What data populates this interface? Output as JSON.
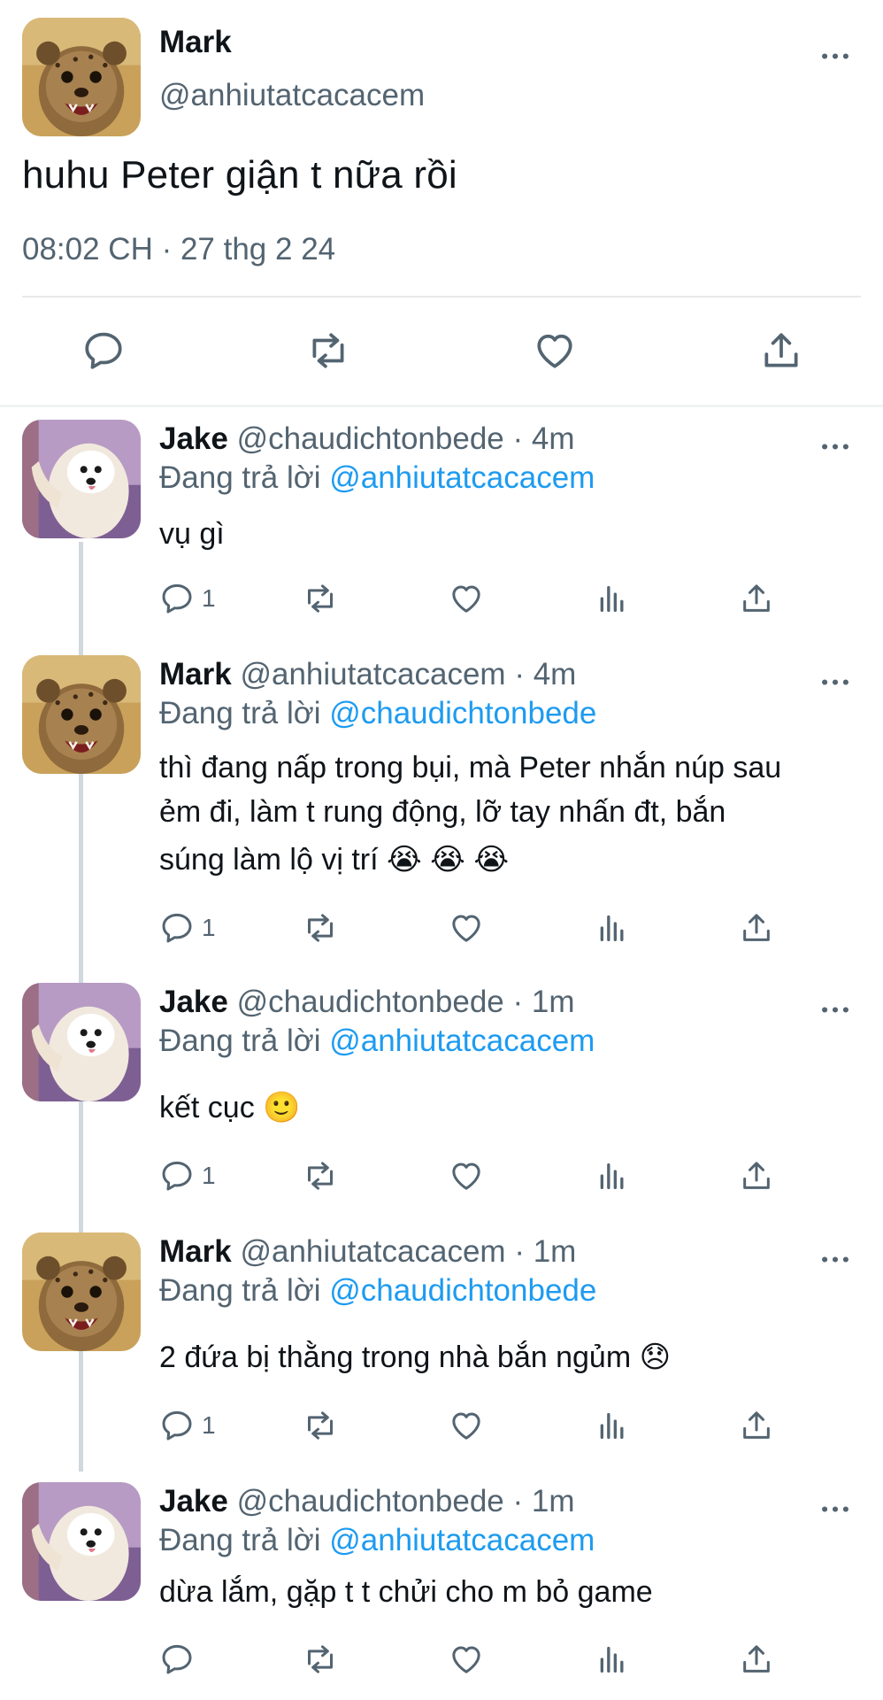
{
  "main_tweet": {
    "author": "Mark",
    "handle": "@anhiutatcacacem",
    "text": "huhu Peter giận t nữa rồi",
    "timestamp": "08:02 CH · 27 thg 2 24",
    "avatar": "cheetah-cub-avatar",
    "actions": [
      "reply-icon",
      "retweet-icon",
      "like-icon",
      "share-icon"
    ]
  },
  "replies": [
    {
      "author": "Jake",
      "handle": "@chaudichtonbede",
      "time": "4m",
      "replying_label": "Đang trả lời",
      "replying_to": "@anhiutatcacacem",
      "text_lines": [
        "vụ gì"
      ],
      "emoji": "",
      "reply_count": "1",
      "avatar": "white-dog-avatar"
    },
    {
      "author": "Mark",
      "handle": "@anhiutatcacacem",
      "time": "4m",
      "replying_label": "Đang trả lời",
      "replying_to": "@chaudichtonbede",
      "text_lines": [
        "thì đang nấp trong bụi, mà Peter nhắn núp sau",
        "ẻm đi, làm t rung động, lỡ tay nhấn đt, bắn",
        "súng làm lộ vị trí"
      ],
      "emoji": "😭 😭 😭",
      "reply_count": "1",
      "avatar": "cheetah-cub-avatar"
    },
    {
      "author": "Jake",
      "handle": "@chaudichtonbede",
      "time": "1m",
      "replying_label": "Đang trả lời",
      "replying_to": "@anhiutatcacacem",
      "text_lines": [
        "kết cục"
      ],
      "emoji": "🙂",
      "reply_count": "1",
      "avatar": "white-dog-avatar"
    },
    {
      "author": "Mark",
      "handle": "@anhiutatcacacem",
      "time": "1m",
      "replying_label": "Đang trả lời",
      "replying_to": "@chaudichtonbede",
      "text_lines": [
        "2 đứa bị thằng trong nhà bắn ngủm"
      ],
      "emoji": "😞",
      "reply_count": "1",
      "avatar": "cheetah-cub-avatar"
    },
    {
      "author": "Jake",
      "handle": "@chaudichtonbede",
      "time": "1m",
      "replying_label": "Đang trả lời",
      "replying_to": "@anhiutatcacacem",
      "text_lines": [
        "dừa lắm, gặp t t chửi cho m bỏ game"
      ],
      "emoji": "",
      "reply_count": "",
      "avatar": "white-dog-avatar"
    }
  ],
  "colors": {
    "text": "#0f1419",
    "secondary": "#536471",
    "link": "#1d9bf0",
    "divider": "#e7e9ea",
    "thread_line": "#cfd9de"
  }
}
